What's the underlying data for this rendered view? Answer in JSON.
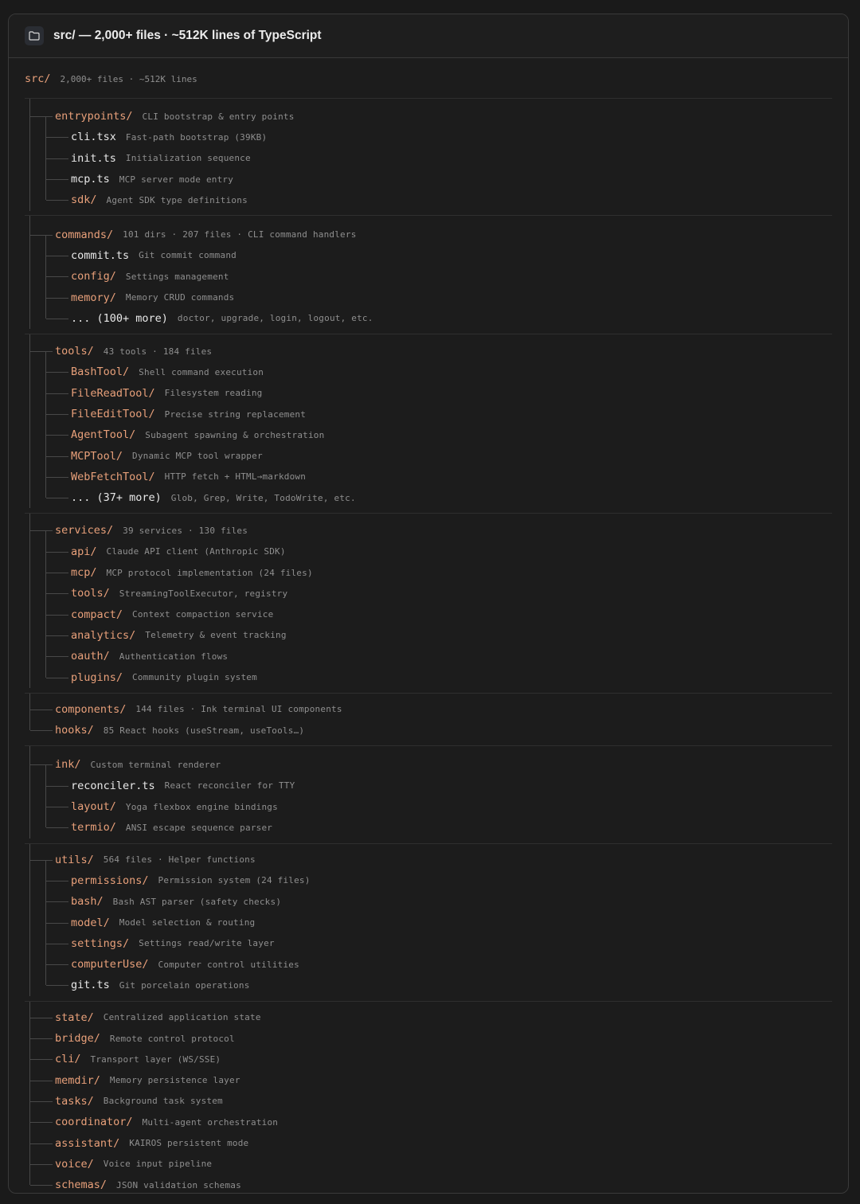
{
  "header": {
    "title": "src/ — 2,000+ files · ~512K lines of TypeScript",
    "folder_icon": "folder-icon"
  },
  "root": {
    "name": "src/",
    "desc": "2,000+ files · ~512K lines"
  },
  "groups": [
    {
      "items": [
        {
          "name": "entrypoints/",
          "desc": "CLI bootstrap & entry points",
          "depth": 0,
          "kind": "dir"
        },
        {
          "name": "cli.tsx",
          "desc": "Fast-path bootstrap (39KB)",
          "depth": 1,
          "kind": "file"
        },
        {
          "name": "init.ts",
          "desc": "Initialization sequence",
          "depth": 1,
          "kind": "file"
        },
        {
          "name": "mcp.ts",
          "desc": "MCP server mode entry",
          "depth": 1,
          "kind": "file"
        },
        {
          "name": "sdk/",
          "desc": "Agent SDK type definitions",
          "depth": 1,
          "kind": "dir"
        }
      ]
    },
    {
      "items": [
        {
          "name": "commands/",
          "desc": "101 dirs · 207 files · CLI command handlers",
          "depth": 0,
          "kind": "dir"
        },
        {
          "name": "commit.ts",
          "desc": "Git commit command",
          "depth": 1,
          "kind": "file"
        },
        {
          "name": "config/",
          "desc": "Settings management",
          "depth": 1,
          "kind": "dir"
        },
        {
          "name": "memory/",
          "desc": "Memory CRUD commands",
          "depth": 1,
          "kind": "dir"
        },
        {
          "name": "... (100+ more)",
          "desc": "doctor, upgrade, login, logout, etc.",
          "depth": 1,
          "kind": "file"
        }
      ]
    },
    {
      "items": [
        {
          "name": "tools/",
          "desc": "43 tools · 184 files",
          "depth": 0,
          "kind": "dir"
        },
        {
          "name": "BashTool/",
          "desc": "Shell command execution",
          "depth": 1,
          "kind": "dir"
        },
        {
          "name": "FileReadTool/",
          "desc": "Filesystem reading",
          "depth": 1,
          "kind": "dir"
        },
        {
          "name": "FileEditTool/",
          "desc": "Precise string replacement",
          "depth": 1,
          "kind": "dir"
        },
        {
          "name": "AgentTool/",
          "desc": "Subagent spawning & orchestration",
          "depth": 1,
          "kind": "dir"
        },
        {
          "name": "MCPTool/",
          "desc": "Dynamic MCP tool wrapper",
          "depth": 1,
          "kind": "dir"
        },
        {
          "name": "WebFetchTool/",
          "desc": "HTTP fetch + HTML→markdown",
          "depth": 1,
          "kind": "dir"
        },
        {
          "name": "... (37+ more)",
          "desc": "Glob, Grep, Write, TodoWrite, etc.",
          "depth": 1,
          "kind": "file"
        }
      ]
    },
    {
      "items": [
        {
          "name": "services/",
          "desc": "39 services · 130 files",
          "depth": 0,
          "kind": "dir"
        },
        {
          "name": "api/",
          "desc": "Claude API client (Anthropic SDK)",
          "depth": 1,
          "kind": "dir"
        },
        {
          "name": "mcp/",
          "desc": "MCP protocol implementation (24 files)",
          "depth": 1,
          "kind": "dir"
        },
        {
          "name": "tools/",
          "desc": "StreamingToolExecutor, registry",
          "depth": 1,
          "kind": "dir"
        },
        {
          "name": "compact/",
          "desc": "Context compaction service",
          "depth": 1,
          "kind": "dir"
        },
        {
          "name": "analytics/",
          "desc": "Telemetry & event tracking",
          "depth": 1,
          "kind": "dir"
        },
        {
          "name": "oauth/",
          "desc": "Authentication flows",
          "depth": 1,
          "kind": "dir"
        },
        {
          "name": "plugins/",
          "desc": "Community plugin system",
          "depth": 1,
          "kind": "dir"
        }
      ]
    },
    {
      "items": [
        {
          "name": "components/",
          "desc": "144 files · Ink terminal UI components",
          "depth": 0,
          "kind": "dir"
        },
        {
          "name": "hooks/",
          "desc": "85 React hooks (useStream, useTools…)",
          "depth": 0,
          "kind": "dir"
        }
      ]
    },
    {
      "items": [
        {
          "name": "ink/",
          "desc": "Custom terminal renderer",
          "depth": 0,
          "kind": "dir"
        },
        {
          "name": "reconciler.ts",
          "desc": "React reconciler for TTY",
          "depth": 1,
          "kind": "file"
        },
        {
          "name": "layout/",
          "desc": "Yoga flexbox engine bindings",
          "depth": 1,
          "kind": "dir"
        },
        {
          "name": "termio/",
          "desc": "ANSI escape sequence parser",
          "depth": 1,
          "kind": "dir"
        }
      ]
    },
    {
      "items": [
        {
          "name": "utils/",
          "desc": "564 files · Helper functions",
          "depth": 0,
          "kind": "dir"
        },
        {
          "name": "permissions/",
          "desc": "Permission system (24 files)",
          "depth": 1,
          "kind": "dir"
        },
        {
          "name": "bash/",
          "desc": "Bash AST parser (safety checks)",
          "depth": 1,
          "kind": "dir"
        },
        {
          "name": "model/",
          "desc": "Model selection & routing",
          "depth": 1,
          "kind": "dir"
        },
        {
          "name": "settings/",
          "desc": "Settings read/write layer",
          "depth": 1,
          "kind": "dir"
        },
        {
          "name": "computerUse/",
          "desc": "Computer control utilities",
          "depth": 1,
          "kind": "dir"
        },
        {
          "name": "git.ts",
          "desc": "Git porcelain operations",
          "depth": 1,
          "kind": "file"
        }
      ]
    },
    {
      "items": [
        {
          "name": "state/",
          "desc": "Centralized application state",
          "depth": 0,
          "kind": "dir"
        },
        {
          "name": "bridge/",
          "desc": "Remote control protocol",
          "depth": 0,
          "kind": "dir"
        },
        {
          "name": "cli/",
          "desc": "Transport layer (WS/SSE)",
          "depth": 0,
          "kind": "dir"
        },
        {
          "name": "memdir/",
          "desc": "Memory persistence layer",
          "depth": 0,
          "kind": "dir"
        },
        {
          "name": "tasks/",
          "desc": "Background task system",
          "depth": 0,
          "kind": "dir"
        },
        {
          "name": "coordinator/",
          "desc": "Multi-agent orchestration",
          "depth": 0,
          "kind": "dir"
        },
        {
          "name": "assistant/",
          "desc": "KAIROS persistent mode",
          "depth": 0,
          "kind": "dir"
        },
        {
          "name": "voice/",
          "desc": "Voice input pipeline",
          "depth": 0,
          "kind": "dir"
        },
        {
          "name": "schemas/",
          "desc": "JSON validation schemas",
          "depth": 0,
          "kind": "dir"
        }
      ]
    }
  ]
}
